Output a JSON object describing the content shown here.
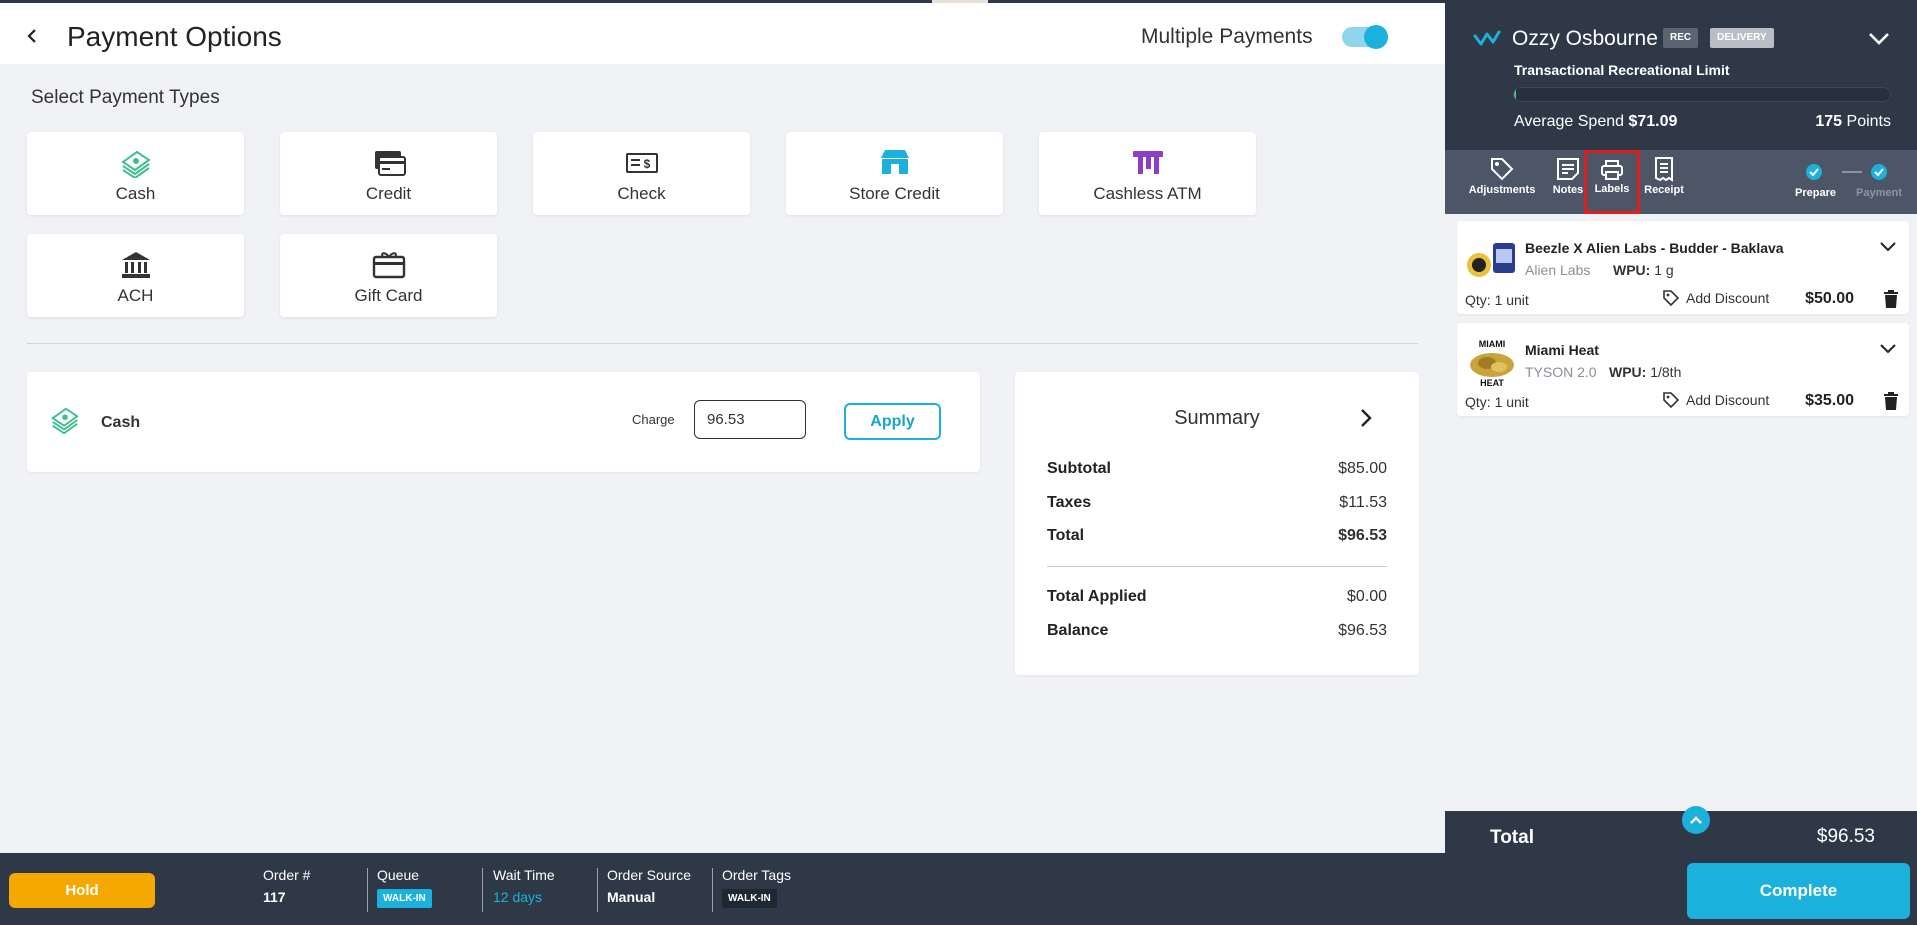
{
  "header": {
    "title": "Payment Options",
    "multiple_payments_label": "Multiple Payments",
    "multiple_payments_on": true
  },
  "payment_types": {
    "section_title": "Select Payment Types",
    "items": [
      {
        "label": "Cash",
        "icon": "cash-icon",
        "color": "#3fbf8f"
      },
      {
        "label": "Credit",
        "icon": "credit-card-icon",
        "color": "#333333"
      },
      {
        "label": "Check",
        "icon": "check-icon",
        "color": "#333333"
      },
      {
        "label": "Store Credit",
        "icon": "store-icon",
        "color": "#1bb1dc"
      },
      {
        "label": "Cashless ATM",
        "icon": "atm-icon",
        "color": "#8a3fc9"
      },
      {
        "label": "ACH",
        "icon": "bank-icon",
        "color": "#333333"
      },
      {
        "label": "Gift Card",
        "icon": "gift-card-icon",
        "color": "#333333"
      }
    ]
  },
  "applied": {
    "method": "Cash",
    "charge_label": "Charge",
    "charge_value": "96.53",
    "apply_label": "Apply"
  },
  "summary": {
    "title": "Summary",
    "subtotal_label": "Subtotal",
    "subtotal": "$85.00",
    "taxes_label": "Taxes",
    "taxes": "$11.53",
    "total_label": "Total",
    "total": "$96.53",
    "total_applied_label": "Total Applied",
    "total_applied": "$0.00",
    "balance_label": "Balance",
    "balance": "$96.53"
  },
  "customer": {
    "name": "Ozzy  Osbourne",
    "badge_rec": "REC",
    "badge_delivery": "DELIVERY",
    "limit_label": "Transactional Recreational Limit",
    "limit_fraction": 0.005,
    "avg_label": "Average Spend",
    "avg_value": "$71.09",
    "points_value": "175",
    "points_label": "Points"
  },
  "tools": {
    "adjustments": "Adjustments",
    "notes": "Notes",
    "labels": "Labels",
    "receipt": "Receipt",
    "step_prepare": "Prepare",
    "step_payment": "Payment"
  },
  "cart": {
    "items": [
      {
        "name": "Beezle X Alien Labs - Budder - Baklava",
        "brand": "Alien Labs",
        "wpu_label": "WPU:",
        "wpu": "1 g",
        "qty_label": "Qty:",
        "qty": "1 unit",
        "discount_label": "Add Discount",
        "price": "$50.00"
      },
      {
        "name": "Miami Heat",
        "brand": "TYSON 2.0",
        "wpu_label": "WPU:",
        "wpu": "1/8th",
        "qty_label": "Qty:",
        "qty": "1 unit",
        "discount_label": "Add Discount",
        "price": "$35.00",
        "image_text": "MIAMI HEAT"
      }
    ],
    "total_label": "Total",
    "total": "$96.53"
  },
  "footer": {
    "hold_label": "Hold",
    "order_label": "Order #",
    "order_value": "117",
    "queue_label": "Queue",
    "queue_tag": "WALK-IN",
    "wait_label": "Wait Time",
    "wait_value": "12 days",
    "source_label": "Order Source",
    "source_value": "Manual",
    "tags_label": "Order Tags",
    "tags_tag": "WALK-IN",
    "complete_label": "Complete"
  },
  "colors": {
    "accent": "#1bb1dc",
    "dark": "#2e3847",
    "hold": "#f5a800"
  }
}
